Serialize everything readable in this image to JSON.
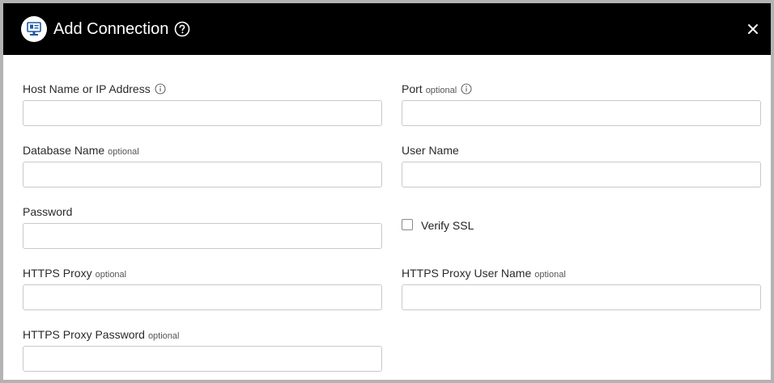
{
  "dialog": {
    "title": "Add Connection",
    "icons": {
      "app": "database-monitor-icon",
      "help": "question-circle-icon",
      "close": "close-icon",
      "info": "info-circle-icon"
    },
    "colors": {
      "header_bg": "#000000",
      "app_icon_fg": "#1f5aa6"
    }
  },
  "form": {
    "host": {
      "label": "Host Name or IP Address",
      "value": "",
      "placeholder": ""
    },
    "port": {
      "label": "Port",
      "optional": "optional",
      "value": "",
      "placeholder": ""
    },
    "database": {
      "label": "Database Name",
      "optional": "optional",
      "value": "",
      "placeholder": ""
    },
    "user": {
      "label": "User Name",
      "value": "",
      "placeholder": ""
    },
    "password": {
      "label": "Password",
      "value": "",
      "placeholder": ""
    },
    "verify_ssl": {
      "label": "Verify SSL",
      "checked": false
    },
    "proxy": {
      "label": "HTTPS Proxy",
      "optional": "optional",
      "value": "",
      "placeholder": ""
    },
    "proxy_user": {
      "label": "HTTPS Proxy User Name",
      "optional": "optional",
      "value": "",
      "placeholder": ""
    },
    "proxy_password": {
      "label": "HTTPS Proxy Password",
      "optional": "optional",
      "value": "",
      "placeholder": ""
    }
  }
}
